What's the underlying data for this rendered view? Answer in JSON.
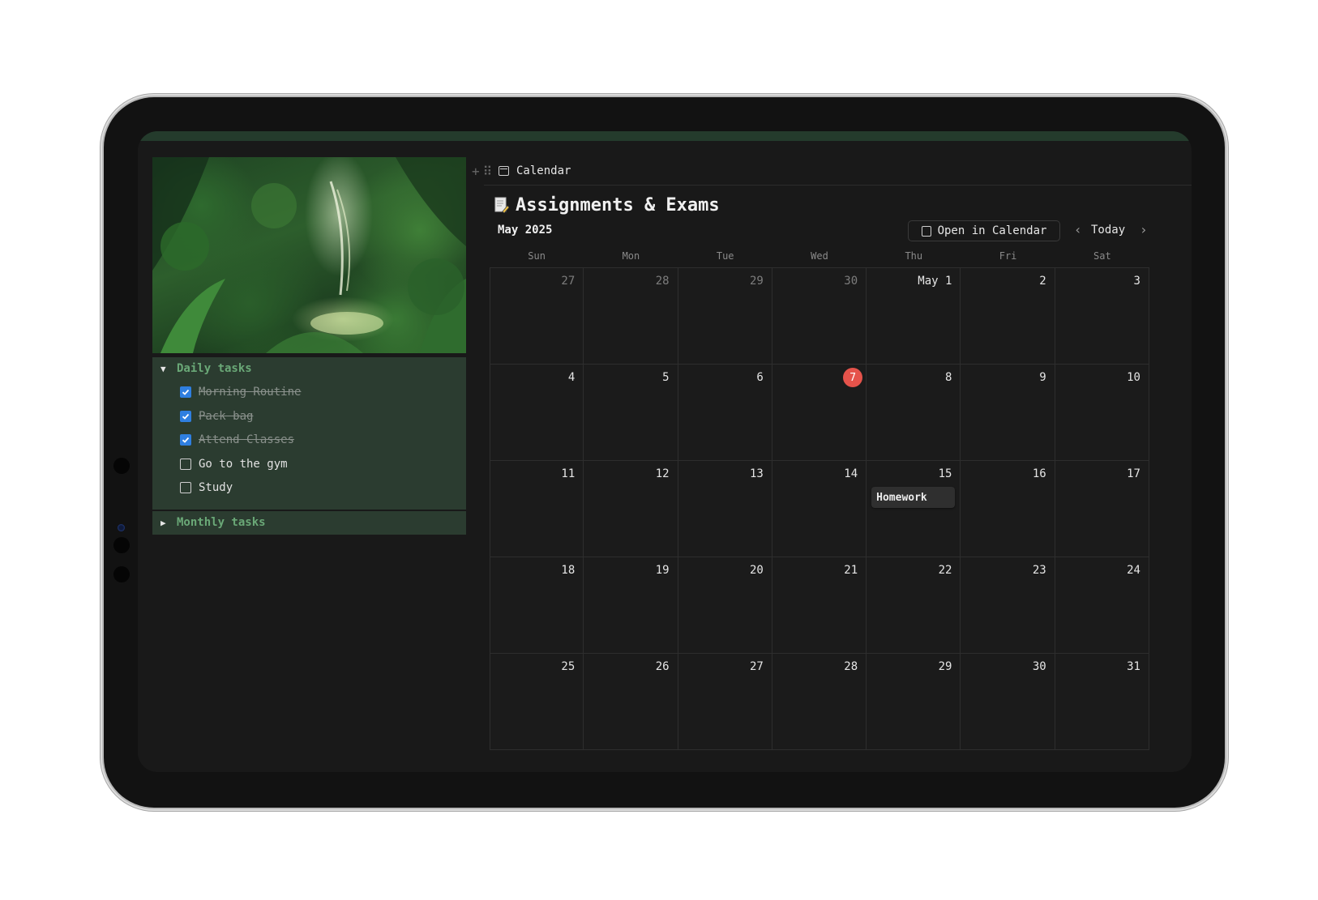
{
  "colors": {
    "screen_bg": "#191919",
    "panel_bg": "#2b3c30",
    "toggle_heading": "#6aa877",
    "checkbox_checked": "#2f7fe0",
    "today_badge": "#e5534b"
  },
  "daily": {
    "title": "Daily tasks",
    "items": [
      {
        "label": "Morning Routine",
        "checked": true
      },
      {
        "label": "Pack bag",
        "checked": true
      },
      {
        "label": "Attend Classes",
        "checked": true
      },
      {
        "label": "Go to the gym",
        "checked": false
      },
      {
        "label": "Study",
        "checked": false
      }
    ]
  },
  "monthly": {
    "title": "Monthly tasks"
  },
  "view": {
    "tab_label": "Calendar",
    "tab_icon": "calendar-icon"
  },
  "database": {
    "title": "Assignments & Exams",
    "icon": "page-icon"
  },
  "calendar": {
    "month_label": "May 2025",
    "open_button": "Open in Calendar",
    "today_button": "Today",
    "weekdays": [
      "Sun",
      "Mon",
      "Tue",
      "Wed",
      "Thu",
      "Fri",
      "Sat"
    ],
    "days": [
      {
        "label": "27",
        "out": true
      },
      {
        "label": "28",
        "out": true
      },
      {
        "label": "29",
        "out": true
      },
      {
        "label": "30",
        "out": true
      },
      {
        "label": "May 1"
      },
      {
        "label": "2"
      },
      {
        "label": "3"
      },
      {
        "label": "4"
      },
      {
        "label": "5"
      },
      {
        "label": "6"
      },
      {
        "label": "7",
        "today": true
      },
      {
        "label": "8"
      },
      {
        "label": "9"
      },
      {
        "label": "10"
      },
      {
        "label": "11"
      },
      {
        "label": "12"
      },
      {
        "label": "13"
      },
      {
        "label": "14"
      },
      {
        "label": "15",
        "event": "Homework"
      },
      {
        "label": "16"
      },
      {
        "label": "17"
      },
      {
        "label": "18"
      },
      {
        "label": "19"
      },
      {
        "label": "20"
      },
      {
        "label": "21"
      },
      {
        "label": "22"
      },
      {
        "label": "23"
      },
      {
        "label": "24"
      },
      {
        "label": "25"
      },
      {
        "label": "26"
      },
      {
        "label": "27"
      },
      {
        "label": "28"
      },
      {
        "label": "29"
      },
      {
        "label": "30"
      },
      {
        "label": "31"
      }
    ]
  }
}
